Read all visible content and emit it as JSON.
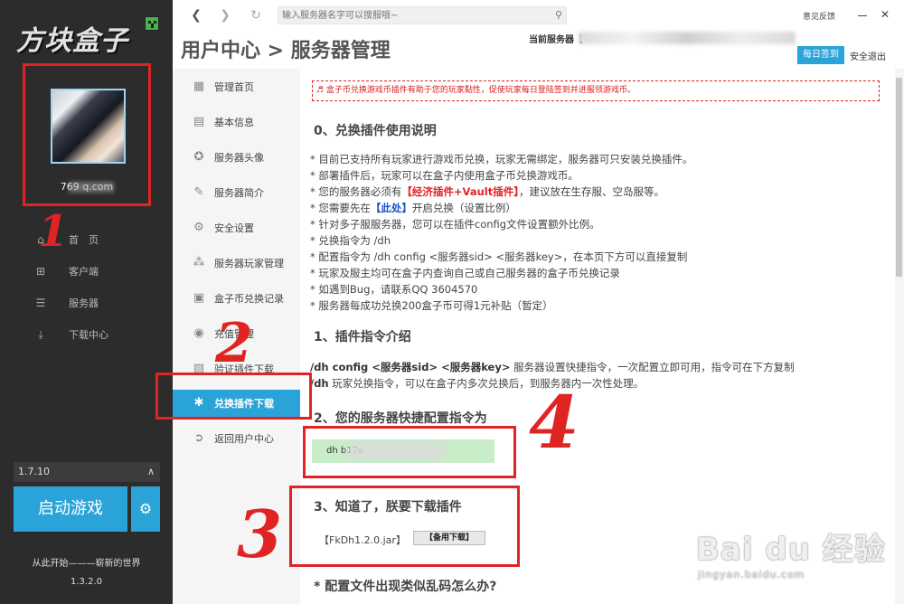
{
  "launcher": {
    "logo_text": "方块盒子",
    "email": "769          q.com",
    "nav": [
      {
        "label": "首　页",
        "icon": "home-icon"
      },
      {
        "label": "客户端",
        "icon": "grid-icon"
      },
      {
        "label": "服务器",
        "icon": "server-icon"
      },
      {
        "label": "下载中心",
        "icon": "download-icon"
      }
    ],
    "version": "1.7.10",
    "launch_label": "启动游戏",
    "slogan": "从此开始———崭新的世界",
    "launcher_version": "1.3.2.0"
  },
  "browser": {
    "search_placeholder": "输入服务器名字可以搜服哦~",
    "feedback": "意见反馈"
  },
  "header": {
    "title": "用户中心 > 服务器管理",
    "current_server_label": "当前服务器【",
    "checkin": "每日签到",
    "logout": "安全退出"
  },
  "subnav": [
    {
      "label": "管理首页",
      "icon": "dashboard-icon"
    },
    {
      "label": "基本信息",
      "icon": "info-icon"
    },
    {
      "label": "服务器头像",
      "icon": "avatar-icon"
    },
    {
      "label": "服务器简介",
      "icon": "edit-icon"
    },
    {
      "label": "安全设置",
      "icon": "settings-icon"
    },
    {
      "label": "服务器玩家管理",
      "icon": "players-icon"
    },
    {
      "label": "盒子币兑换记录",
      "icon": "record-icon"
    },
    {
      "label": "充值管理",
      "icon": "recharge-icon"
    },
    {
      "label": "验证插件下载",
      "icon": "verify-icon"
    },
    {
      "label": "兑换插件下载",
      "icon": "exchange-icon"
    },
    {
      "label": "返回用户中心",
      "icon": "back-icon"
    }
  ],
  "content": {
    "notice": "♬ 盒子币兑换游戏币插件有助于您的玩家黏性，促使玩家每日登陆签到并进服领游戏币。",
    "s0_title": "0、兑换插件使用说明",
    "s0": {
      "l1": "* 目前已支持所有玩家进行游戏币兑换，玩家无需绑定，服务器可只安装兑换插件。",
      "l2": "* 部署插件后，玩家可以在盒子内使用盒子币兑换游戏币。",
      "l3_a": "* 您的服务器必须有",
      "l3_b": "【经济插件+Vault插件】",
      "l3_c": "，建议放在生存服、空岛服等。",
      "l4_a": "* 您需要先在",
      "l4_b": "【此处】",
      "l4_c": "开启兑换（设置比例）",
      "l5": "* 针对多子服服务器，您可以在插件config文件设置额外比例。",
      "l6": "* 兑换指令为 /dh",
      "l7": "* 配置指令为 /dh config <服务器sid> <服务器key>，在本页下方可以直接复制",
      "l8": "* 玩家及服主均可在盒子内查询自己或自己服务器的盒子币兑换记录",
      "l9": "* 如遇到Bug，请联系QQ 3604570",
      "l10": "* 服务器每成功兑换200盒子币可得1元补贴（暂定）"
    },
    "s1_title": "1、插件指令介绍",
    "s1": {
      "l1_cmd": "/dh config <服务器sid> <服务器key>",
      "l1_text": " 服务器设置快捷指令，一次配置立即可用，指令可在下方复制",
      "l2_cmd": "/dh",
      "l2_text": " 玩家兑换指令，可以在盒子内多次兑换后，到服务器内一次性处理。"
    },
    "s2_title": "2、您的服务器快捷配置指令为",
    "cmd_value": "dh                              b17a",
    "s3_title": "3、知道了，朕要下载插件",
    "jar_name": "【FkDh1.2.0.jar】",
    "mirror_label": "【备用下载】",
    "faq_title": "* 配置文件出现类似乱码怎么办?"
  },
  "annotations": [
    "1",
    "2",
    "3",
    "4"
  ],
  "watermark": {
    "main": "Bai du 经验",
    "sub": "jingyan.baidu.com"
  },
  "colors": {
    "accent": "#2aa3d8",
    "annotation": "#e02424",
    "sidebar_bg": "#2c2c2c"
  }
}
